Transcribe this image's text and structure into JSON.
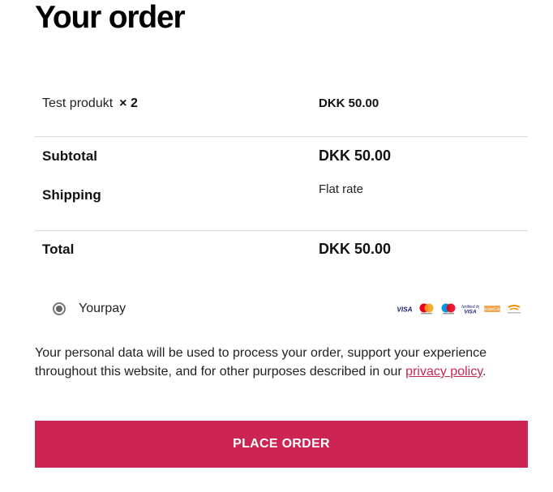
{
  "page": {
    "title": "Your order"
  },
  "order": {
    "product": {
      "name": "Test produkt",
      "qty": "× 2",
      "price": "DKK 50.00"
    },
    "subtotal": {
      "label": "Subtotal",
      "value": "DKK 50.00"
    },
    "shipping": {
      "label": "Shipping",
      "value": "Flat rate"
    },
    "total": {
      "label": "Total",
      "value": "DKK 50.00"
    }
  },
  "payment": {
    "method_label": "Yourpay",
    "selected": true,
    "card_icons": [
      "visa-icon",
      "mastercard-icon",
      "maestro-icon",
      "visa-electron-icon",
      "dankort-icon",
      "mobilepay-icon"
    ]
  },
  "privacy": {
    "text_before": "Your personal data will be used to process your order, support your experience throughout this website, and for other purposes described in our ",
    "link_text": "privacy policy",
    "text_after": "."
  },
  "actions": {
    "place_order": "PLACE ORDER"
  },
  "colors": {
    "accent": "#cc2553",
    "link": "#c6294f",
    "divider": "#dcdcdc"
  }
}
